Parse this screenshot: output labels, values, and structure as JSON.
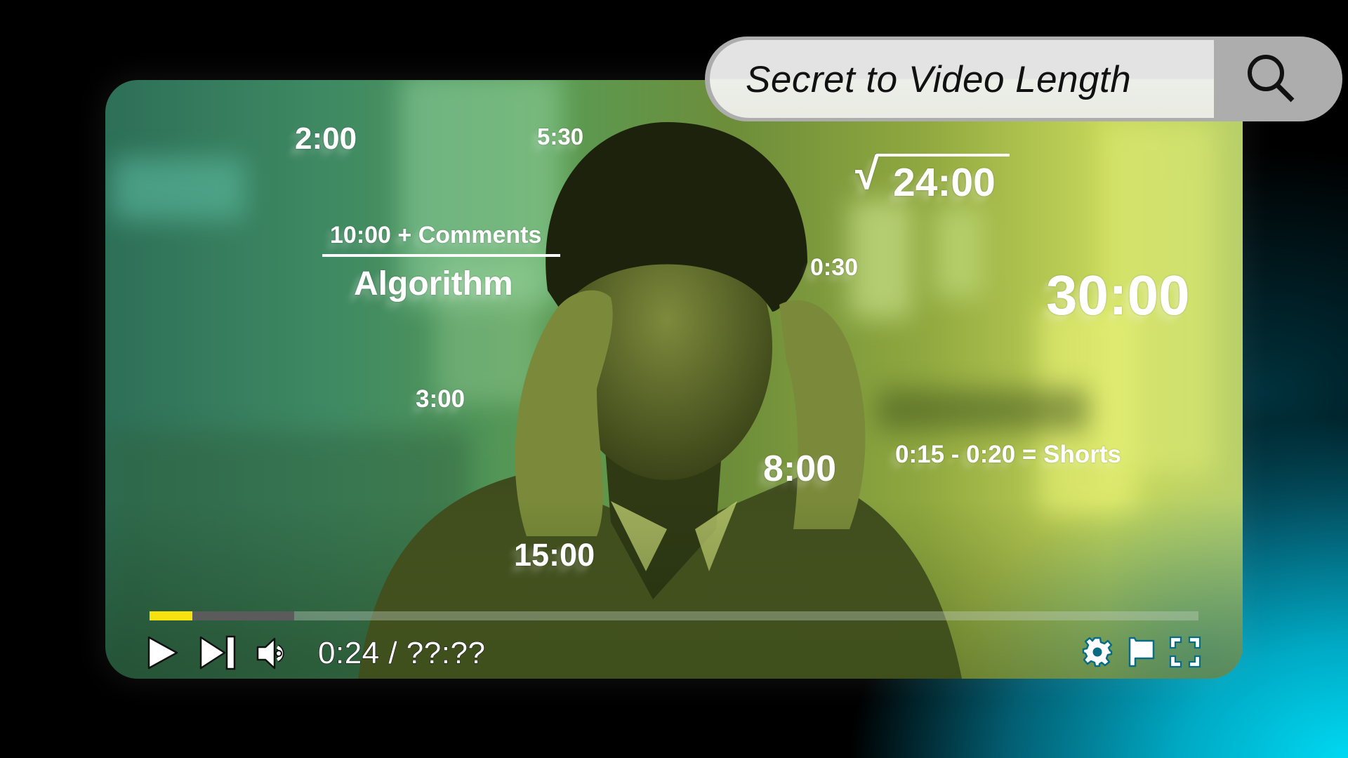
{
  "search": {
    "query": "Secret to Video Length",
    "icon": "search-icon"
  },
  "video": {
    "overlay_labels": {
      "two_min": "2:00",
      "five_thirty": "5:30",
      "sqrt_24": "24:00",
      "sqrt_symbol": "√",
      "numerator": "10:00 + Comments",
      "denominator": "Algorithm",
      "zero_thirty": "0:30",
      "thirty_min": "30:00",
      "three_min": "3:00",
      "eight_min": "8:00",
      "shorts": "0:15 - 0:20 = Shorts",
      "fifteen_min": "15:00"
    },
    "colors": {
      "played": "#f7e210",
      "buffered": "#5b5b5b",
      "accent_glow": "#00dcf5"
    }
  },
  "controls": {
    "time_display": "0:24 / ??:??",
    "progress_played_fraction": 0.041,
    "progress_buffered_fraction": 0.138,
    "icons": [
      "play-icon",
      "next-icon",
      "volume-icon",
      "settings-gear-icon",
      "flag-icon",
      "fullscreen-icon"
    ]
  }
}
